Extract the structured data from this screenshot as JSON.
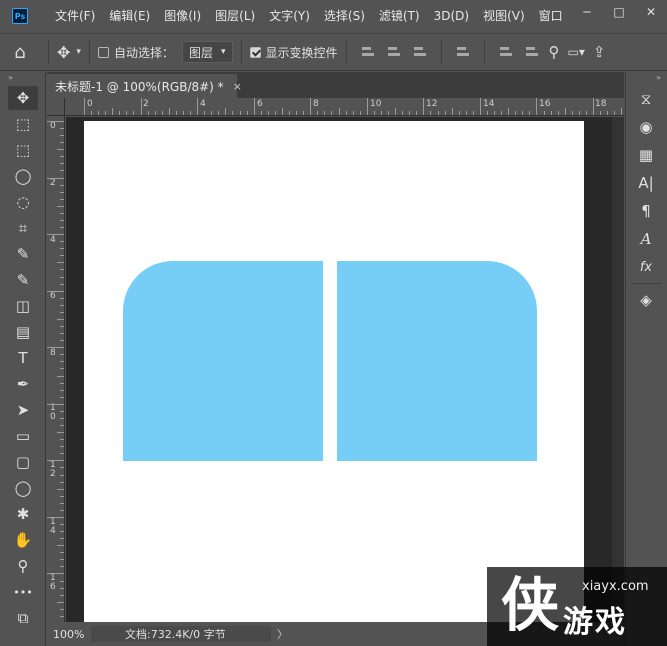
{
  "app": {
    "logo": "Ps"
  },
  "menubar": {
    "items": [
      "文件(F)",
      "编辑(E)",
      "图像(I)",
      "图层(L)",
      "文字(Y)",
      "选择(S)",
      "滤镜(T)",
      "3D(D)",
      "视图(V)",
      "窗口"
    ]
  },
  "window_controls": {
    "minimize": "─",
    "maximize": "□",
    "close": "✕"
  },
  "options_bar": {
    "home_icon": "⌂",
    "move_icon": "✥",
    "auto_select_label": "自动选择：",
    "auto_select_checked": false,
    "layer_select_value": "图层",
    "show_transform_label": "显示变换控件",
    "show_transform_checked": true,
    "search_icon": "⚲",
    "share_icon": "⇪"
  },
  "document_tab": {
    "title": "未标题-1 @ 100%(RGB/8#) *",
    "close": "×"
  },
  "ruler_h_labels": [
    "0",
    "2",
    "4",
    "6",
    "8",
    "10",
    "12",
    "14",
    "16",
    "18"
  ],
  "ruler_v_labels": [
    "0",
    "2",
    "4",
    "6",
    "8",
    "10",
    "12",
    "14",
    "16"
  ],
  "canvas": {
    "background": "#ffffff",
    "shape_color": "#76cdf5"
  },
  "status_bar": {
    "zoom": "100%",
    "doc_info": "文档:732.4K/0 字节",
    "arrow": "〉"
  },
  "tools": {
    "move": "✥",
    "artboard": "⬚",
    "marquee": "⬚",
    "lasso": "◯",
    "quick_select": "◌",
    "crop": "⌗",
    "eyedropper": "✎",
    "brush": "✎",
    "eraser": "◫",
    "gradient": "▤",
    "type": "T",
    "pen": "✒",
    "path_select": "➤",
    "rectangle": "▭",
    "rounded_rect": "▢",
    "ellipse": "◯",
    "custom_shape": "✱",
    "hand": "✋",
    "zoom": "⚲",
    "more": "•••",
    "colors": "⧉"
  },
  "right_panel": {
    "history": "⧖",
    "color": "◉",
    "swatches": "▦",
    "character": "A|",
    "paragraph": "¶",
    "glyphs": "A",
    "styles": "fx",
    "layers": "◈"
  },
  "watermark": {
    "big_char": "侠",
    "url": "xiayx.com",
    "name": "游戏"
  }
}
